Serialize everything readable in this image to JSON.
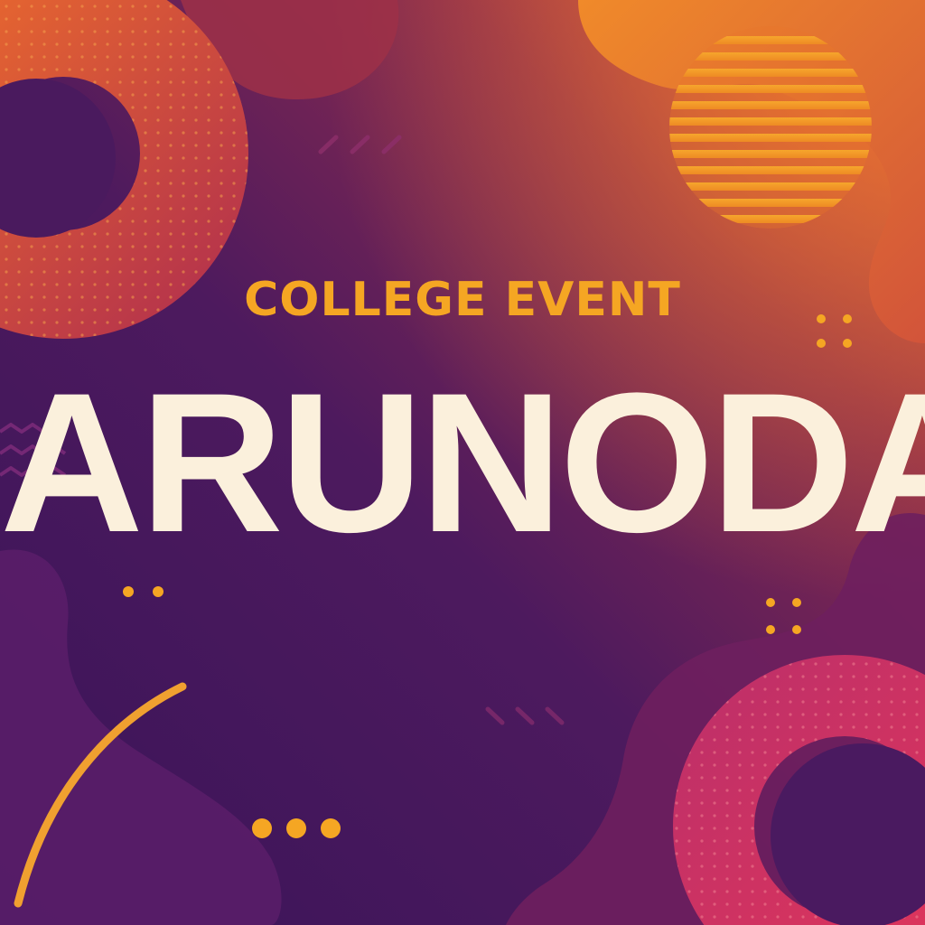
{
  "poster": {
    "subtitle": "COLLEGE EVENT",
    "title": "ARUNODAY"
  },
  "colors": {
    "background_dark": "#3a1459",
    "background_warm": "#c2453a",
    "accent_orange": "#f5a623",
    "title_cream": "#fbf0dc",
    "magenta": "#d7315f"
  }
}
